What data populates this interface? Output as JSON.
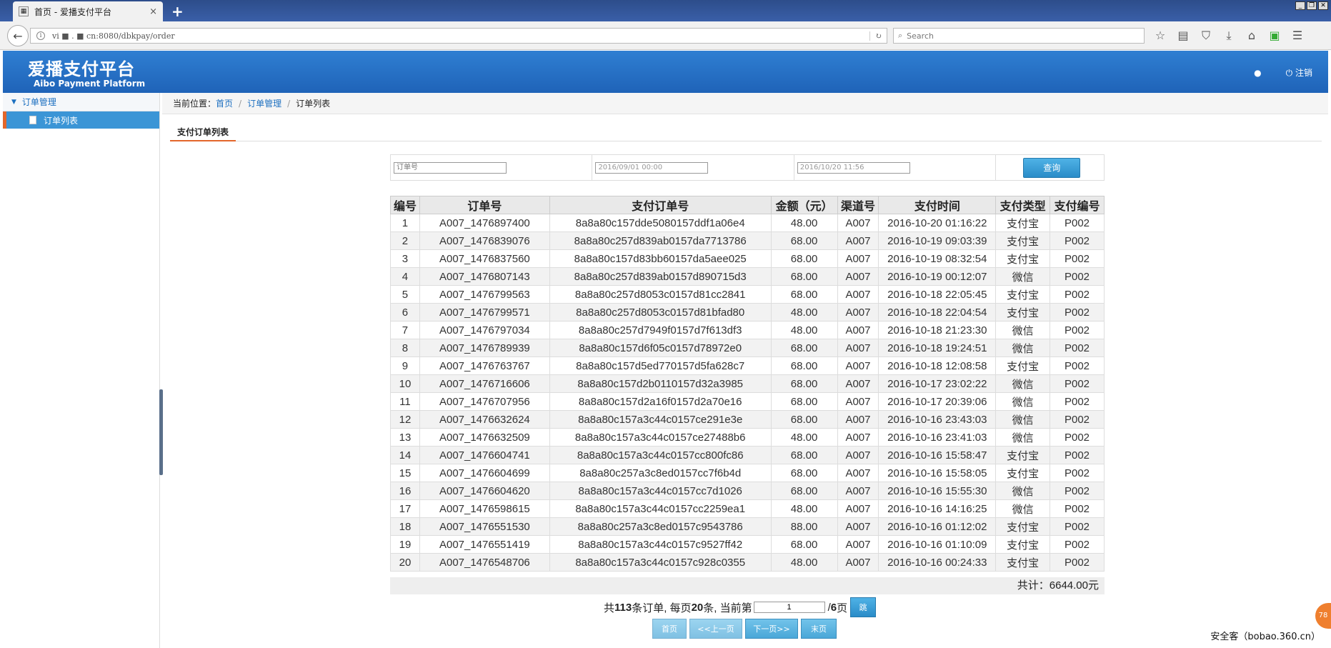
{
  "browser": {
    "tab_title": "首页 - 爱播支付平台",
    "tab_close": "×",
    "new_tab": "+",
    "url": "vi ■ .  ■ cn:8080/dbkpay/order",
    "search_placeholder": "Search"
  },
  "header": {
    "brand_cn": "爱播支付平台",
    "brand_en": "Aibo Payment Platform",
    "logout": "注销"
  },
  "sidebar": {
    "group": "订单管理",
    "item": "订单列表"
  },
  "breadcrumb": {
    "prefix": "当前位置：",
    "home": "首页",
    "section": "订单管理",
    "current": "订单列表",
    "sep": "/"
  },
  "tab": "支付订单列表",
  "filter": {
    "order_placeholder": "订单号",
    "start_time": "2016/09/01 00:00",
    "end_time": "2016/10/20 11:56",
    "query": "查询"
  },
  "table": {
    "headers": [
      "编号",
      "订单号",
      "支付订单号",
      "金额（元）",
      "渠道号",
      "支付时间",
      "支付类型",
      "支付编号"
    ],
    "rows": [
      [
        "1",
        "A007_1476897400",
        "8a8a80c157dde5080157ddf1a06e4",
        "48.00",
        "A007",
        "2016-10-20 01:16:22",
        "支付宝",
        "P002"
      ],
      [
        "2",
        "A007_1476839076",
        "8a8a80c257d839ab0157da7713786",
        "68.00",
        "A007",
        "2016-10-19 09:03:39",
        "支付宝",
        "P002"
      ],
      [
        "3",
        "A007_1476837560",
        "8a8a80c157d83bb60157da5aee025",
        "68.00",
        "A007",
        "2016-10-19 08:32:54",
        "支付宝",
        "P002"
      ],
      [
        "4",
        "A007_1476807143",
        "8a8a80c257d839ab0157d890715d3",
        "68.00",
        "A007",
        "2016-10-19 00:12:07",
        "微信",
        "P002"
      ],
      [
        "5",
        "A007_1476799563",
        "8a8a80c257d8053c0157d81cc2841",
        "68.00",
        "A007",
        "2016-10-18 22:05:45",
        "支付宝",
        "P002"
      ],
      [
        "6",
        "A007_1476799571",
        "8a8a80c257d8053c0157d81bfad80",
        "48.00",
        "A007",
        "2016-10-18 22:04:54",
        "支付宝",
        "P002"
      ],
      [
        "7",
        "A007_1476797034",
        "8a8a80c257d7949f0157d7f613df3",
        "48.00",
        "A007",
        "2016-10-18 21:23:30",
        "微信",
        "P002"
      ],
      [
        "8",
        "A007_1476789939",
        "8a8a80c157d6f05c0157d78972e0",
        "68.00",
        "A007",
        "2016-10-18 19:24:51",
        "微信",
        "P002"
      ],
      [
        "9",
        "A007_1476763767",
        "8a8a80c157d5ed770157d5fa628c7",
        "68.00",
        "A007",
        "2016-10-18 12:08:58",
        "支付宝",
        "P002"
      ],
      [
        "10",
        "A007_1476716606",
        "8a8a80c157d2b0110157d32a3985",
        "68.00",
        "A007",
        "2016-10-17 23:02:22",
        "微信",
        "P002"
      ],
      [
        "11",
        "A007_1476707956",
        "8a8a80c157d2a16f0157d2a70e16",
        "68.00",
        "A007",
        "2016-10-17 20:39:06",
        "微信",
        "P002"
      ],
      [
        "12",
        "A007_1476632624",
        "8a8a80c157a3c44c0157ce291e3e",
        "68.00",
        "A007",
        "2016-10-16 23:43:03",
        "微信",
        "P002"
      ],
      [
        "13",
        "A007_1476632509",
        "8a8a80c157a3c44c0157ce27488b6",
        "48.00",
        "A007",
        "2016-10-16 23:41:03",
        "微信",
        "P002"
      ],
      [
        "14",
        "A007_1476604741",
        "8a8a80c157a3c44c0157cc800fc86",
        "68.00",
        "A007",
        "2016-10-16 15:58:47",
        "支付宝",
        "P002"
      ],
      [
        "15",
        "A007_1476604699",
        "8a8a80c257a3c8ed0157cc7f6b4d",
        "68.00",
        "A007",
        "2016-10-16 15:58:05",
        "支付宝",
        "P002"
      ],
      [
        "16",
        "A007_1476604620",
        "8a8a80c157a3c44c0157cc7d1026",
        "68.00",
        "A007",
        "2016-10-16 15:55:30",
        "微信",
        "P002"
      ],
      [
        "17",
        "A007_1476598615",
        "8a8a80c157a3c44c0157cc2259ea1",
        "48.00",
        "A007",
        "2016-10-16 14:16:25",
        "微信",
        "P002"
      ],
      [
        "18",
        "A007_1476551530",
        "8a8a80c257a3c8ed0157c9543786",
        "88.00",
        "A007",
        "2016-10-16 01:12:02",
        "支付宝",
        "P002"
      ],
      [
        "19",
        "A007_1476551419",
        "8a8a80c157a3c44c0157c9527ff42",
        "68.00",
        "A007",
        "2016-10-16 01:10:09",
        "支付宝",
        "P002"
      ],
      [
        "20",
        "A007_1476548706",
        "8a8a80c157a3c44c0157c928c0355",
        "48.00",
        "A007",
        "2016-10-16 00:24:33",
        "支付宝",
        "P002"
      ]
    ]
  },
  "summary": {
    "total": "共计：6644.00元"
  },
  "pager": {
    "text1": "共",
    "count": "113",
    "text2": "条订单, 每页",
    "per_page": "20",
    "text3": "条, 当前第",
    "current_page": "1",
    "text4": "/",
    "total_pages": "6",
    "text5": "页",
    "go": "跳",
    "first": "首页",
    "prev": "<<上一页",
    "next": "下一页>>",
    "last": "末页"
  },
  "watermark": "安全客（bobao.360.cn）",
  "badge": "78"
}
